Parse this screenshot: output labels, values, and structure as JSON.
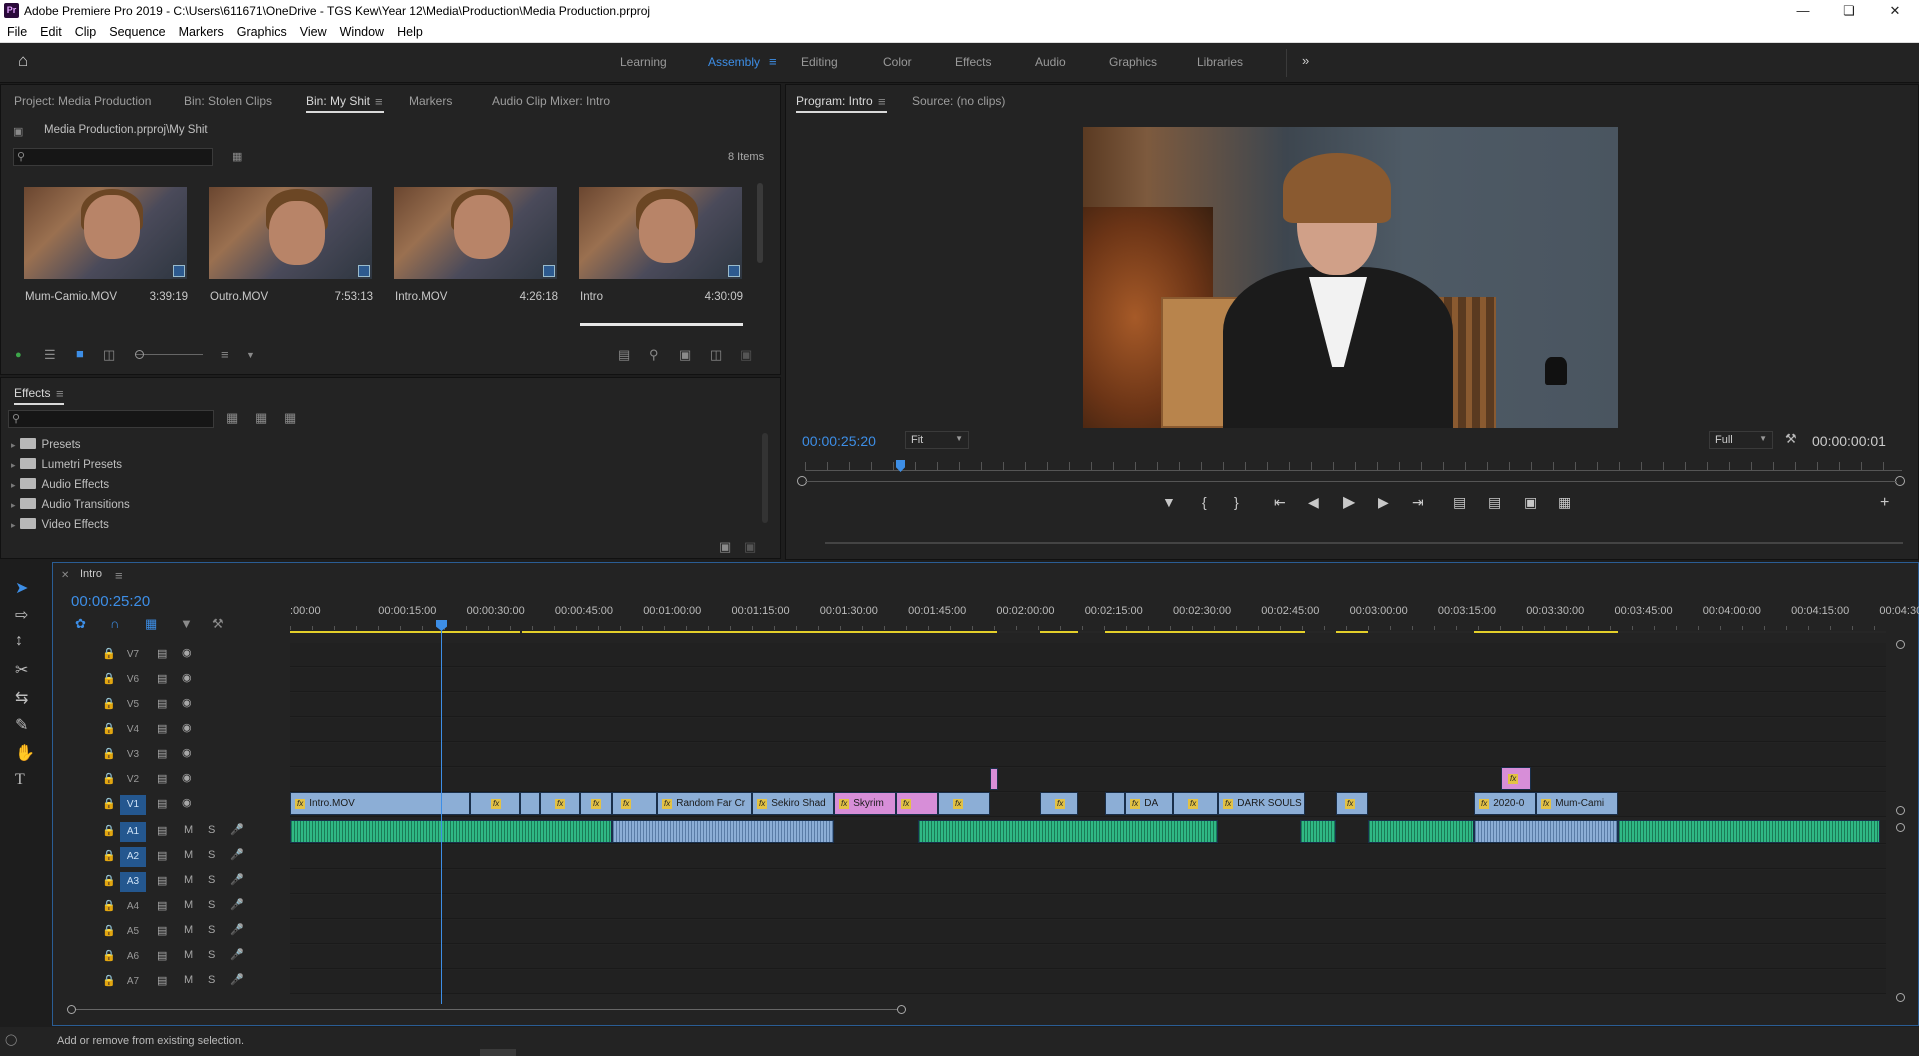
{
  "window": {
    "title": "Adobe Premiere Pro 2019 - C:\\Users\\611671\\OneDrive - TGS Kew\\Year 12\\Media\\Production\\Media Production.prproj",
    "logo": "Pr"
  },
  "menu": [
    "File",
    "Edit",
    "Clip",
    "Sequence",
    "Markers",
    "Graphics",
    "View",
    "Window",
    "Help"
  ],
  "workspaces": [
    "Learning",
    "Assembly",
    "Editing",
    "Color",
    "Effects",
    "Audio",
    "Graphics",
    "Libraries"
  ],
  "workspace_active": "Assembly",
  "project_panel": {
    "tabs": [
      "Project: Media Production",
      "Bin: Stolen Clips",
      "Bin: My Shit",
      "Markers",
      "Audio Clip Mixer: Intro"
    ],
    "active_tab": "Bin: My Shit",
    "path": "Media Production.prproj\\My Shit",
    "item_count": "8 Items",
    "items": [
      {
        "name": "Mum-Camio.MOV",
        "duration": "3:39:19"
      },
      {
        "name": "Outro.MOV",
        "duration": "7:53:13"
      },
      {
        "name": "Intro.MOV",
        "duration": "4:26:18"
      },
      {
        "name": "Intro",
        "duration": "4:30:09"
      }
    ]
  },
  "effects_panel": {
    "title": "Effects",
    "folders": [
      "Presets",
      "Lumetri Presets",
      "Audio Effects",
      "Audio Transitions",
      "Video Effects"
    ]
  },
  "program_monitor": {
    "tabs": [
      "Program: Intro",
      "Source: (no clips)"
    ],
    "timecode": "00:00:25:20",
    "fit": "Fit",
    "resolution": "Full",
    "duration": "00:00:00:01"
  },
  "timeline": {
    "sequence": "Intro",
    "timecode": "00:00:25:20",
    "ruler": [
      ":00:00",
      "00:00:15:00",
      "00:00:30:00",
      "00:00:45:00",
      "00:01:00:00",
      "00:01:15:00",
      "00:01:30:00",
      "00:01:45:00",
      "00:02:00:00",
      "00:02:15:00",
      "00:02:30:00",
      "00:02:45:00",
      "00:03:00:00",
      "00:03:15:00",
      "00:03:30:00",
      "00:03:45:00",
      "00:04:00:00",
      "00:04:15:00",
      "00:04:30"
    ],
    "video_tracks": [
      "V7",
      "V6",
      "V5",
      "V4",
      "V3",
      "V2",
      "V1"
    ],
    "audio_tracks": [
      "A1",
      "A2",
      "A3",
      "A4",
      "A5",
      "A6",
      "A7"
    ],
    "track_mute": "M",
    "track_solo": "S",
    "v1_clips": [
      "Intro.MOV",
      "Random Far Cr",
      "Sekiro Shad",
      "Skyrim",
      "DA",
      "DARK SOULS",
      "2020-0",
      "Mum-Cami"
    ],
    "fx_label": "fx"
  },
  "status_bar": "Add or remove from existing selection."
}
